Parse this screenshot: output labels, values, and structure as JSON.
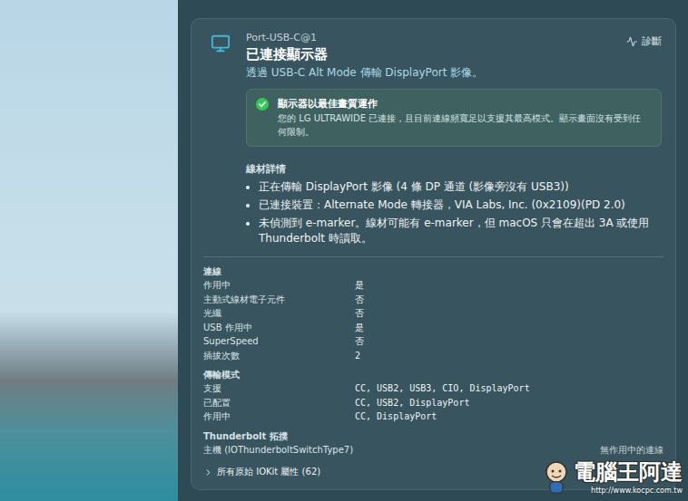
{
  "port": {
    "name": "Port-USB-C@1",
    "title": "已連接顯示器",
    "subtitle": "透過 USB-C Alt Mode 傳輸 DisplayPort 影像。",
    "diagnostics": "診斷"
  },
  "status": {
    "ok": true,
    "title": "顯示器以最佳畫質運作",
    "message": "您的 LG ULTRAWIDE 已連接，且目前連線頻寬足以支援其最高模式。顯示畫面沒有受到任何限制。"
  },
  "cable": {
    "heading": "線材詳情",
    "bullets": [
      "正在傳輸 DisplayPort 影像 (4 條 DP 通道 (影像旁沒有 USB3))",
      "已連接裝置：Alternate Mode 轉接器，VIA Labs, Inc. (0x2109)(PD 2.0)",
      "未偵測到 e-marker。線材可能有 e-marker，但 macOS 只會在超出 3A 或使用 Thunderbolt 時讀取。"
    ]
  },
  "sections": [
    {
      "title": "連線",
      "kind": "grid",
      "rows": [
        {
          "label": "作用中",
          "value": "是"
        },
        {
          "label": "主動式線材電子元件",
          "value": "否"
        },
        {
          "label": "光纖",
          "value": "否"
        },
        {
          "label": "USB 作用中",
          "value": "是"
        },
        {
          "label": "SuperSpeed",
          "value": "否"
        },
        {
          "label": "插拔次數",
          "value": "2"
        }
      ]
    },
    {
      "title": "傳輸模式",
      "kind": "grid",
      "rows": [
        {
          "label": "支援",
          "value": "CC, USB2, USB3, CIO, DisplayPort"
        },
        {
          "label": "已配置",
          "value": "CC, USB2, DisplayPort"
        },
        {
          "label": "作用中",
          "value": "CC, DisplayPort"
        }
      ]
    },
    {
      "title": "Thunderbolt 拓撲",
      "kind": "split",
      "rows": [
        {
          "label": "主機 (IOThunderboltSwitchType7)",
          "value": "無作用中的連線"
        }
      ]
    }
  ],
  "disclosure": {
    "label": "所有原始 IOKit 屬性 (62)",
    "expanded": false
  },
  "watermark": {
    "name": "電腦王阿達",
    "url": "http://www.kocpc.com.tw"
  }
}
